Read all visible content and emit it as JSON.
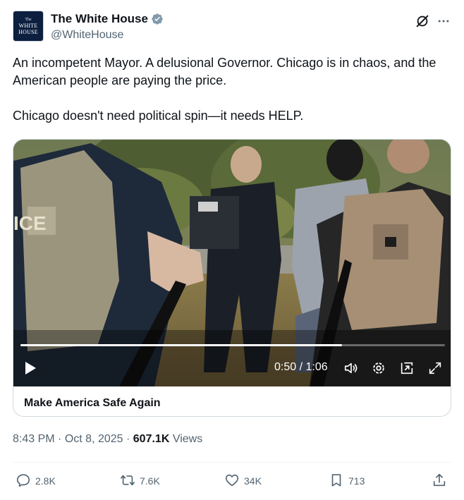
{
  "author": {
    "display_name": "The White House",
    "handle": "@WhiteHouse",
    "avatar_line1": "The",
    "avatar_line2": "WHITE",
    "avatar_line3": "HOUSE"
  },
  "tweet": {
    "line1": "An incompetent Mayor. A delusional Governor. Chicago is in chaos, and the American people are paying the price.",
    "line2": "Chicago doesn't need political spin—it needs HELP."
  },
  "video": {
    "time_display": "0:50 / 1:06",
    "progress_fraction": 0.758,
    "card_title": "Make America Safe Again",
    "vest_label": "ICE"
  },
  "meta": {
    "time": "8:43 PM",
    "separator": "·",
    "date": "Oct 8, 2025",
    "views_count": "607.1K",
    "views_label": "Views"
  },
  "actions": {
    "replies": "2.8K",
    "reposts": "7.6K",
    "likes": "34K",
    "bookmarks": "713"
  },
  "icons": {
    "verified": "verified-badge-icon",
    "grok": "grok-icon",
    "more": "more-icon",
    "play": "play-icon",
    "volume": "volume-icon",
    "settings": "gear-icon",
    "pip": "picture-in-picture-icon",
    "fullscreen": "expand-icon",
    "reply": "reply-icon",
    "repost": "repost-icon",
    "like": "heart-icon",
    "bookmark": "bookmark-icon",
    "share": "share-icon"
  },
  "colors": {
    "text_primary": "#0f1419",
    "text_secondary": "#536471",
    "verified_gray": "#829aab",
    "border": "#cfd9de"
  }
}
